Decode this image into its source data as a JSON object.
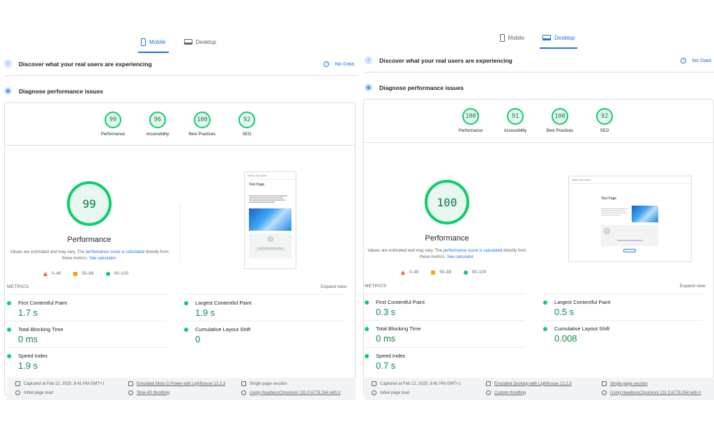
{
  "mobile": {
    "tabs": [
      {
        "label": "Mobile",
        "active": true
      },
      {
        "label": "Desktop",
        "active": false
      }
    ],
    "discover": {
      "text": "Discover what your real users are experiencing",
      "no_data": "No Data"
    },
    "diagnose": {
      "text": "Diagnose performance issues"
    },
    "gauges": [
      {
        "label": "Performance",
        "score": "99"
      },
      {
        "label": "Accessibility",
        "score": "96"
      },
      {
        "label": "Best Practices",
        "score": "100"
      },
      {
        "label": "SEO",
        "score": "92"
      }
    ],
    "main_score": "99",
    "main_title": "Performance",
    "estimate": {
      "pre": "Values are estimated and may vary. The ",
      "link1": "performance score is calculated",
      "mid": " directly from these metrics. ",
      "link2": "See calculator."
    },
    "legend": [
      "0–49",
      "50–89",
      "90–100"
    ],
    "screenshot": {
      "header": "Ambient spin imperio",
      "title": "Test Page"
    },
    "metrics_label": "METRICS",
    "expand_label": "Expand view",
    "metrics": [
      {
        "name": "First Contentful Paint",
        "value": "1.7 s"
      },
      {
        "name": "Largest Contentful Paint",
        "value": "1.9 s"
      },
      {
        "name": "Total Blocking Time",
        "value": "0 ms"
      },
      {
        "name": "Cumulative Layout Shift",
        "value": "0"
      },
      {
        "name": "Speed Index",
        "value": "1.9 s"
      }
    ],
    "footer": {
      "captured": "Captured at Feb 12, 2025, 8:41 PM GMT+1",
      "emulated": "Emulated Moto G Power with Lighthouse 12.2.3",
      "session": "Single page session",
      "load": "Initial page load",
      "throttle": "Slow 4G throttling",
      "browser": "Using HeadlessChromium 131.0.6778.264 with lr"
    }
  },
  "desktop": {
    "tabs": [
      {
        "label": "Mobile",
        "active": false
      },
      {
        "label": "Desktop",
        "active": true
      }
    ],
    "discover": {
      "text": "Discover what your real users are experiencing",
      "no_data": "No Data"
    },
    "diagnose": {
      "text": "Diagnose performance issues"
    },
    "gauges": [
      {
        "label": "Performance",
        "score": "100"
      },
      {
        "label": "Accessibility",
        "score": "91"
      },
      {
        "label": "Best Practices",
        "score": "100"
      },
      {
        "label": "SEO",
        "score": "92"
      }
    ],
    "main_score": "100",
    "main_title": "Performance",
    "estimate": {
      "pre": "Values are estimated and may vary. The ",
      "link1": "performance score is calculated",
      "mid": " directly from these metrics. ",
      "link2": "See calculator."
    },
    "legend": [
      "0–49",
      "50–89",
      "90–100"
    ],
    "screenshot": {
      "header": "Ambient spin imperio",
      "title": "Test Page"
    },
    "metrics_label": "METRICS",
    "expand_label": "Expand view",
    "metrics": [
      {
        "name": "First Contentful Paint",
        "value": "0.3 s"
      },
      {
        "name": "Largest Contentful Paint",
        "value": "0.5 s"
      },
      {
        "name": "Total Blocking Time",
        "value": "0 ms"
      },
      {
        "name": "Cumulative Layout Shift",
        "value": "0.008"
      },
      {
        "name": "Speed Index",
        "value": "0.7 s"
      }
    ],
    "footer": {
      "captured": "Captured at Feb 12, 2025, 8:41 PM GMT+1",
      "emulated": "Emulated Desktop with Lighthouse 12.2.3",
      "session": "Single page session",
      "load": "Initial page load",
      "throttle": "Custom throttling",
      "browser": "Using HeadlessChromium 131.0.6778.264 with lr"
    }
  },
  "colors": {
    "good": "#0cce6b",
    "average": "#ffa400",
    "fail": "#ff4e42",
    "accent": "#1a73e8"
  }
}
